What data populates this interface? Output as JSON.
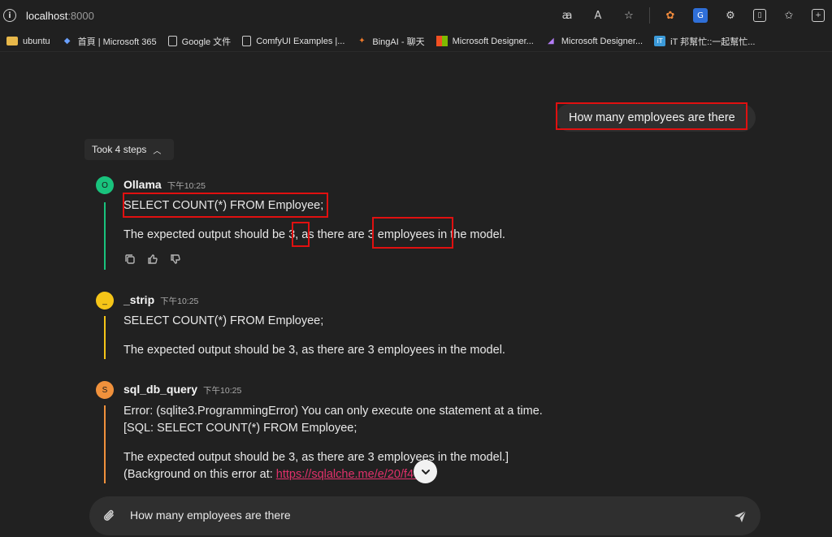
{
  "browser": {
    "url_host": "localhost",
    "url_port": ":8000",
    "bookmarks": [
      {
        "label": "ubuntu",
        "icon": "folder-icon"
      },
      {
        "label": "首頁 | Microsoft 365",
        "icon": "m365-icon"
      },
      {
        "label": "Google 文件",
        "icon": "doc-icon"
      },
      {
        "label": "ComfyUI Examples |...",
        "icon": "doc-icon"
      },
      {
        "label": "BingAI - 聊天",
        "icon": "bing-icon"
      },
      {
        "label": "Microsoft Designer...",
        "icon": "microsoft-icon"
      },
      {
        "label": "Microsoft Designer...",
        "icon": "designer-icon"
      },
      {
        "label": "iT 邦幫忙::一起幫忙...",
        "icon": "ithome-icon"
      }
    ]
  },
  "chat": {
    "user_message": "How many employees are there",
    "steps_label": "Took 4 steps",
    "messages": [
      {
        "avatar": "O",
        "name": "Ollama",
        "time": "下午10:25",
        "lines": [
          "SELECT COUNT(*) FROM Employee;",
          "The expected output should be 3, as there are 3 employees in the model."
        ],
        "color": "#19c37d"
      },
      {
        "avatar": "_",
        "name": "_strip",
        "time": "下午10:25",
        "lines": [
          "SELECT COUNT(*) FROM Employee;",
          "The expected output should be 3, as there are 3 employees in the model."
        ],
        "color": "#f5c518"
      },
      {
        "avatar": "S",
        "name": "sql_db_query",
        "time": "下午10:25",
        "lines": [
          "Error: (sqlite3.ProgrammingError) You can only execute one statement at a time.",
          "[SQL: SELECT COUNT(*) FROM Employee;",
          "The expected output should be 3, as there are 3 employees in the model.]",
          "(Background on this error at: ",
          ")"
        ],
        "link": "https://sqlalche.me/e/20/f405",
        "color": "#f0913c"
      }
    ]
  },
  "composer": {
    "value": "How many employees are there"
  },
  "colors": {
    "background": "#212121",
    "highlight": "#e01010",
    "link": "#e0306a"
  }
}
